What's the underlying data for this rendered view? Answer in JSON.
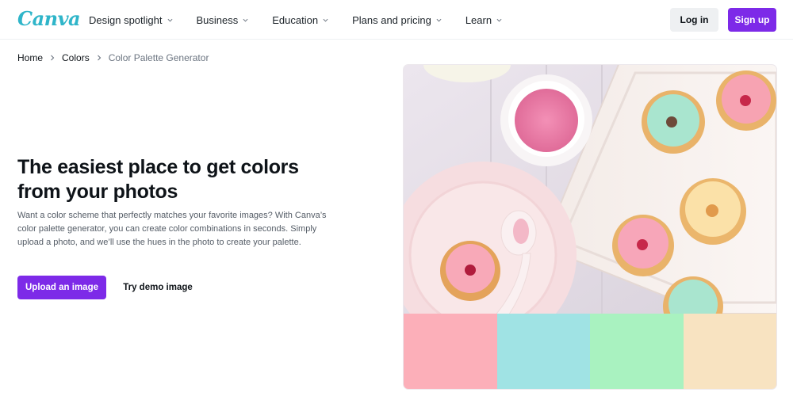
{
  "header": {
    "logo": "Canva",
    "nav": [
      {
        "label": "Design spotlight"
      },
      {
        "label": "Business"
      },
      {
        "label": "Education"
      },
      {
        "label": "Plans and pricing"
      },
      {
        "label": "Learn"
      }
    ],
    "login_label": "Log in",
    "signup_label": "Sign up"
  },
  "breadcrumb": {
    "items": [
      "Home",
      "Colors",
      "Color Palette Generator"
    ]
  },
  "hero": {
    "headline_line1": "The easiest place to get colors",
    "headline_line2": "from your photos",
    "description": "Want a color scheme that perfectly matches your favorite images? With Canva’s color palette generator, you can create color combinations in seconds. Simply upload a photo, and we’ll use the hues in the photo to create your palette.",
    "upload_label": "Upload an image",
    "demo_label": "Try demo image"
  },
  "palette": {
    "colors": [
      "#FCAFB9",
      "#A0E3E4",
      "#A9F2C0",
      "#F8E3C1"
    ]
  },
  "icons": {
    "nav_dropdown": "chevron-down-icon",
    "breadcrumb_separator": "chevron-right-icon"
  },
  "colors": {
    "brand_purple": "#7D2AE8",
    "logo_teal": "#2FB5C9"
  }
}
